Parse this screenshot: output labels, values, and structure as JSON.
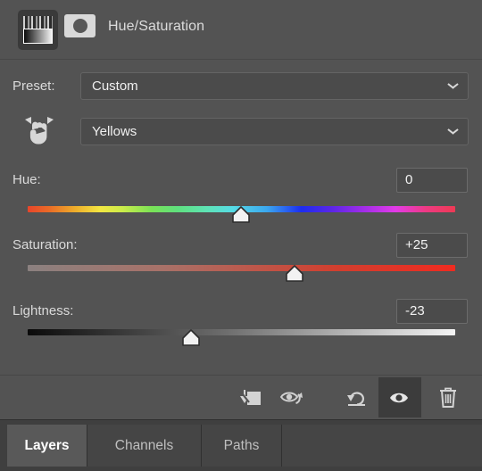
{
  "panel": {
    "title": "Hue/Saturation",
    "adjustment_thumbnail_icon": "hue-saturation-thumbnail-icon",
    "mask_thumbnail_icon": "layer-mask-thumbnail-icon"
  },
  "preset": {
    "label": "Preset:",
    "value": "Custom",
    "chevron_icon": "chevron-down-icon"
  },
  "range": {
    "on_image_adjust_icon": "on-image-adjustment-hand-icon",
    "value": "Yellows",
    "chevron_icon": "chevron-down-icon"
  },
  "sliders": [
    {
      "label": "Hue:",
      "value": "0",
      "name": "hue"
    },
    {
      "label": "Saturation:",
      "value": "+25",
      "name": "saturation"
    },
    {
      "label": "Lightness:",
      "value": "-23",
      "name": "lightness"
    }
  ],
  "toolbar": {
    "buttons": [
      {
        "name": "clip-to-layer-button",
        "icon": "clip-to-layer-icon",
        "active": false
      },
      {
        "name": "view-previous-state-button",
        "icon": "eye-with-arrow-icon",
        "active": false
      },
      {
        "name": "reset-adjustment-button",
        "icon": "reset-arrow-icon",
        "active": false
      },
      {
        "name": "toggle-layer-visibility-button",
        "icon": "eye-icon",
        "active": true
      },
      {
        "name": "delete-adjustment-layer-button",
        "icon": "trash-icon",
        "active": false
      }
    ]
  },
  "tabs": [
    {
      "label": "Layers",
      "active": true
    },
    {
      "label": "Channels",
      "active": false
    },
    {
      "label": "Paths",
      "active": false
    }
  ],
  "colors": {
    "panel_background": "#535353",
    "field_background": "#4b4b4b",
    "text": "#dadada",
    "active_tab_background": "#595959",
    "hue_gradient_start": "#e8452a",
    "hue_gradient_end": "#ee3a54",
    "saturation_gradient_start": "#8b8180",
    "saturation_gradient_end": "#ef2b20",
    "lightness_gradient_start": "#0a0a0a",
    "lightness_gradient_end": "#f4f4f4"
  }
}
